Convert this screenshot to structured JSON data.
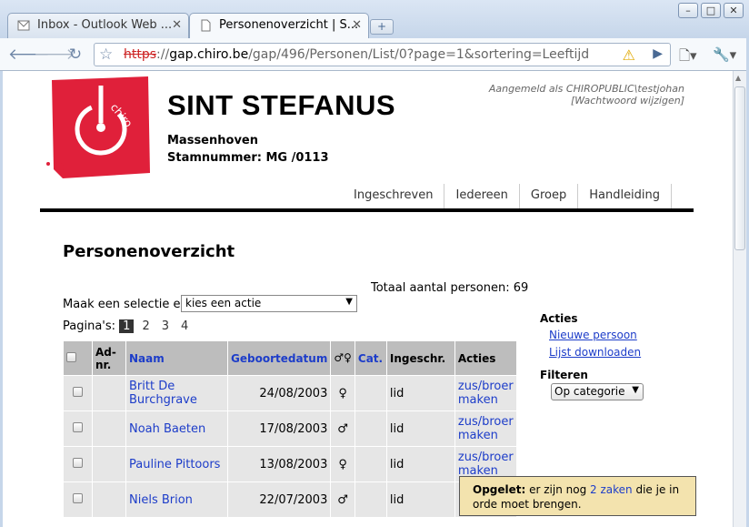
{
  "browser": {
    "tabs": [
      {
        "label": "Inbox - Outlook Web ...",
        "active": false
      },
      {
        "label": "Personenoverzicht | S...",
        "active": true
      }
    ],
    "url_scheme": "https",
    "url_sep": "://",
    "url_host": "gap.chiro.be",
    "url_path": "/gap/496/Personen/List/0?page=1&sortering=Leeftijd"
  },
  "header": {
    "org_name": "SINT STEFANUS",
    "place": "Massenhoven",
    "stamnummer": "Stamnummer: MG /0113",
    "logged_in": "Aangemeld als CHIROPUBLIC\\testjohan",
    "change_password": "[Wachtwoord wijzigen]",
    "logo_text": "chiro"
  },
  "nav": [
    "Ingeschreven",
    "Iedereen",
    "Groep",
    "Handleiding"
  ],
  "main": {
    "title": "Personenoverzicht",
    "total": "Totaal aantal personen: 69",
    "select_label": "Maak een selectie en",
    "select_value": "kies een actie",
    "pages_label": "Pagina's:",
    "pages": [
      "1",
      "2",
      "3",
      "4"
    ],
    "current_page": "1"
  },
  "table": {
    "headers": {
      "adnr": "Ad-nr.",
      "naam": "Naam",
      "geboortedatum": "Geboortedatum",
      "gender": "♂♀",
      "cat": "Cat.",
      "ingeschr": "Ingeschr.",
      "acties": "Acties"
    },
    "rows": [
      {
        "adnr": "",
        "naam": "Britt De Burchgrave",
        "geboortedatum": "24/08/2003",
        "gender": "♀",
        "cat": "",
        "ingeschr": "lid",
        "actie": "zus/broer maken"
      },
      {
        "adnr": "",
        "naam": "Noah Baeten",
        "geboortedatum": "17/08/2003",
        "gender": "♂",
        "cat": "",
        "ingeschr": "lid",
        "actie": "zus/broer maken"
      },
      {
        "adnr": "",
        "naam": "Pauline Pittoors",
        "geboortedatum": "13/08/2003",
        "gender": "♀",
        "cat": "",
        "ingeschr": "lid",
        "actie": "zus/broer maken"
      },
      {
        "adnr": "",
        "naam": "Niels Brion",
        "geboortedatum": "22/07/2003",
        "gender": "♂",
        "cat": "",
        "ingeschr": "lid",
        "actie": ""
      }
    ]
  },
  "sidebar": {
    "acties_title": "Acties",
    "new_person": "Nieuwe persoon",
    "download": "Lijst downloaden",
    "filter_title": "Filteren",
    "filter_value": "Op categorie"
  },
  "notice": {
    "bold": "Opgelet:",
    "text1": " er zijn nog ",
    "link": "2 zaken",
    "text2": " die je in orde moet brengen."
  },
  "colors": {
    "logo_red": "#e0203a",
    "notice_bg": "#f3e3ae",
    "link": "#1d3dc9"
  }
}
